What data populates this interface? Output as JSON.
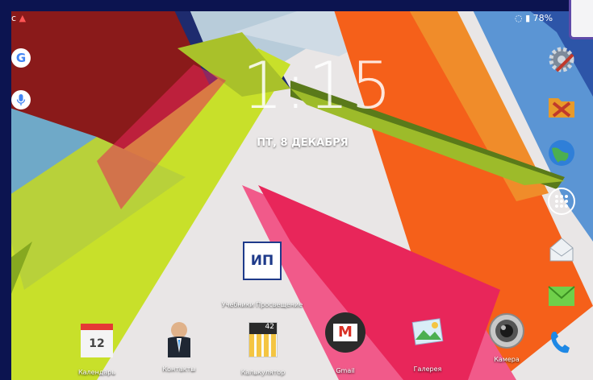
{
  "status_bar": {
    "battery": "78%"
  },
  "lock_clock": {
    "time": "1:15",
    "date": "ПТ, 8 ДЕКАБРЯ"
  },
  "dock_center": {
    "label": "Учебники Просвещение",
    "badge": "ИП"
  },
  "dock": [
    {
      "label": "Календарь",
      "icon": "calendar-icon",
      "day": "12"
    },
    {
      "label": "Контакты",
      "icon": "contacts-icon"
    },
    {
      "label": "Калькулятор",
      "icon": "calculator-icon",
      "display": "42"
    },
    {
      "label": "Gmail",
      "icon": "gmail-icon"
    },
    {
      "label": "Галерея",
      "icon": "gallery-icon"
    },
    {
      "label": "Камера",
      "icon": "camera-icon"
    }
  ],
  "colors": {
    "lime": "#c8e02a",
    "pink": "#e8265a",
    "orange": "#f5601a",
    "maroon": "#8a1a1a",
    "navy": "#1a2a6a"
  }
}
